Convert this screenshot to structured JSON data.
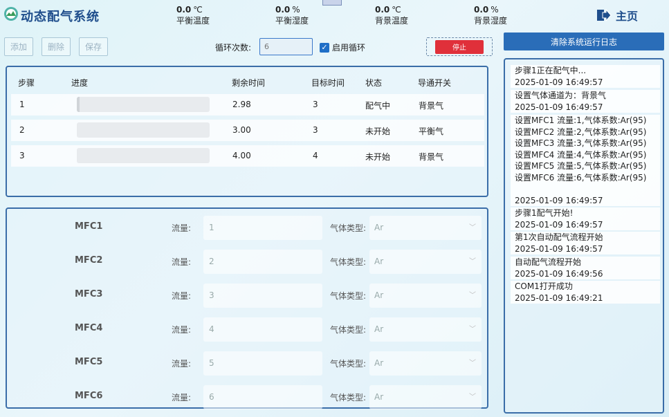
{
  "header": {
    "title": "动态配气系统",
    "home_label": "主页",
    "metrics": [
      {
        "value": "0.0",
        "unit": "℃",
        "label": "平衡温度"
      },
      {
        "value": "0.0",
        "unit": "%",
        "label": "平衡湿度"
      },
      {
        "value": "0.0",
        "unit": "℃",
        "label": "背景温度"
      },
      {
        "value": "0.0",
        "unit": "%",
        "label": "背景湿度"
      }
    ]
  },
  "toolbar": {
    "add_label": "添加",
    "delete_label": "删除",
    "save_label": "保存",
    "loop_count_label": "循环次数:",
    "loop_count_value": "6",
    "enable_loop_label": "启用循环",
    "stop_label": "停止",
    "clear_log_label": "清除系统运行日志"
  },
  "steps_table": {
    "columns": [
      "步骤",
      "进度",
      "剩余时间",
      "目标时间",
      "状态",
      "导通开关"
    ],
    "rows": [
      {
        "step": "1",
        "progress": 0.02,
        "remaining": "2.98",
        "target": "3",
        "status": "配气中",
        "switch": "背景气"
      },
      {
        "step": "2",
        "progress": 0,
        "remaining": "3.00",
        "target": "3",
        "status": "未开始",
        "switch": "平衡气"
      },
      {
        "step": "3",
        "progress": 0,
        "remaining": "4.00",
        "target": "4",
        "status": "未开始",
        "switch": "背景气"
      }
    ]
  },
  "mfc": {
    "flow_label": "流量:",
    "gas_label": "气体类型:",
    "rows": [
      {
        "name": "MFC1",
        "flow": "1",
        "gas": "Ar"
      },
      {
        "name": "MFC2",
        "flow": "2",
        "gas": "Ar"
      },
      {
        "name": "MFC3",
        "flow": "3",
        "gas": "Ar"
      },
      {
        "name": "MFC4",
        "flow": "4",
        "gas": "Ar"
      },
      {
        "name": "MFC5",
        "flow": "5",
        "gas": "Ar"
      },
      {
        "name": "MFC6",
        "flow": "6",
        "gas": "Ar"
      }
    ]
  },
  "log": [
    {
      "lines": [
        "步骤1正在配气中...",
        "2025-01-09 16:49:57"
      ]
    },
    {
      "lines": [
        "设置气体通道为：背景气",
        "2025-01-09 16:49:57"
      ]
    },
    {
      "lines": [
        "设置MFC1   流量:1,气体系数:Ar(95)",
        "设置MFC2   流量:2,气体系数:Ar(95)",
        "设置MFC3   流量:3,气体系数:Ar(95)",
        "设置MFC4   流量:4,气体系数:Ar(95)",
        "设置MFC5   流量:5,气体系数:Ar(95)",
        "设置MFC6   流量:6,气体系数:Ar(95)",
        "",
        "2025-01-09 16:49:57"
      ]
    },
    {
      "lines": [
        "步骤1配气开始!",
        "2025-01-09 16:49:57"
      ]
    },
    {
      "lines": [
        "第1次自动配气流程开始",
        "2025-01-09 16:49:57"
      ]
    },
    {
      "lines": [
        "自动配气流程开始",
        "2025-01-09 16:49:56"
      ]
    },
    {
      "lines": [
        "COM1打开成功",
        "2025-01-09 16:49:21"
      ]
    }
  ],
  "colors": {
    "accent": "#2a6db8",
    "stop": "#e0303a",
    "title": "#1f4e8c"
  }
}
